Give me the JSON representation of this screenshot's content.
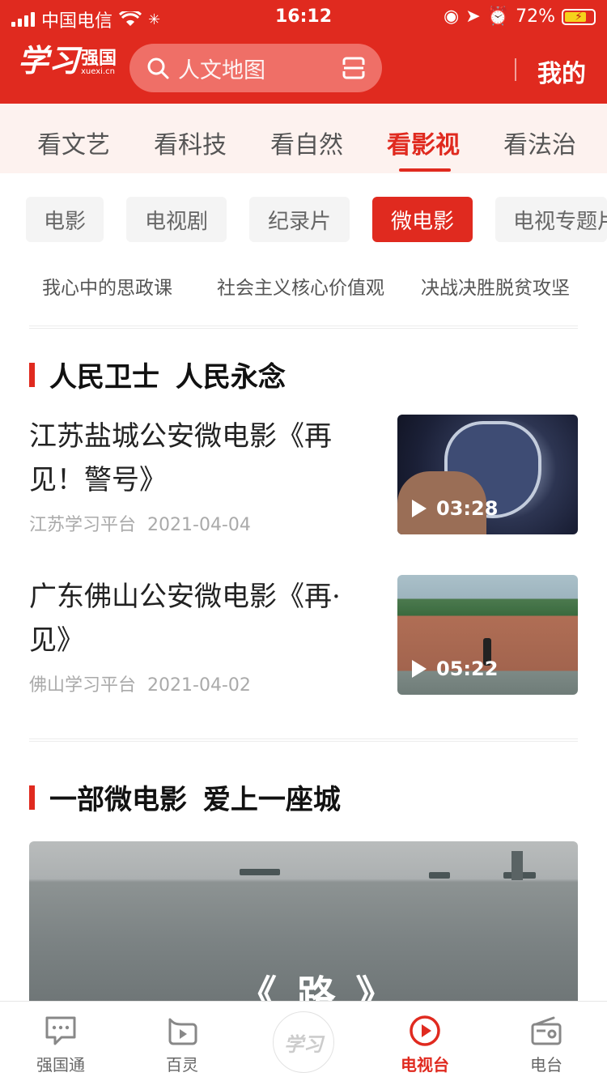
{
  "status": {
    "carrier": "中国电信",
    "time": "16:12",
    "battery": "72%"
  },
  "header": {
    "logo_script": "学习",
    "logo_text": "强国",
    "logo_sub": "xuexi.cn",
    "search_placeholder": "人文地图",
    "mine": "我的"
  },
  "categories": [
    {
      "label": "看文艺",
      "active": false
    },
    {
      "label": "看科技",
      "active": false
    },
    {
      "label": "看自然",
      "active": false
    },
    {
      "label": "看影视",
      "active": true
    },
    {
      "label": "看法治",
      "active": false
    }
  ],
  "chips": [
    {
      "label": "电影",
      "active": false
    },
    {
      "label": "电视剧",
      "active": false
    },
    {
      "label": "纪录片",
      "active": false
    },
    {
      "label": "微电影",
      "active": true
    },
    {
      "label": "电视专题片",
      "active": false
    }
  ],
  "tags": [
    "我心中的思政课",
    "社会主义核心价值观",
    "决战决胜脱贫攻坚"
  ],
  "section1": {
    "title": "人民卫士 人民永念",
    "items": [
      {
        "title": "江苏盐城公安微电影《再见！警号》",
        "source": "江苏学习平台",
        "date": "2021-04-04",
        "duration": "03:28"
      },
      {
        "title": "广东佛山公安微电影《再·见》",
        "source": "佛山学习平台",
        "date": "2021-04-02",
        "duration": "05:22"
      }
    ]
  },
  "section2": {
    "title": "一部微电影 爱上一座城",
    "banner_text": "《 路 》"
  },
  "tabbar": [
    {
      "label": "强国通",
      "icon": "chat-icon",
      "active": false
    },
    {
      "label": "百灵",
      "icon": "video-play-icon",
      "active": false
    },
    {
      "label": "学习",
      "icon": "xuexi-logo-icon",
      "active": false
    },
    {
      "label": "电视台",
      "icon": "play-circle-icon",
      "active": true
    },
    {
      "label": "电台",
      "icon": "radio-icon",
      "active": false
    }
  ],
  "colors": {
    "brand_red": "#e02a1f",
    "category_bg": "#fdf2ef"
  }
}
